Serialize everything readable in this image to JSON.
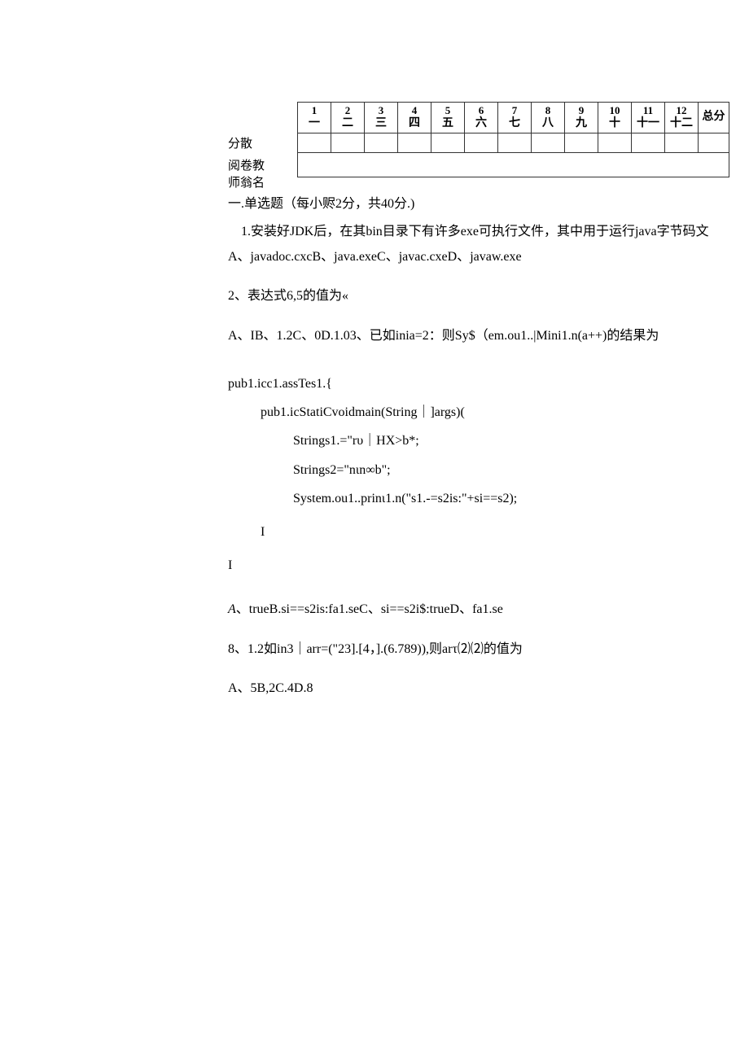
{
  "table": {
    "headers_num": [
      "1",
      "2",
      "3",
      "4",
      "5",
      "6",
      "7",
      "8",
      "9",
      "10",
      "11",
      "12"
    ],
    "headers_cn": [
      "一",
      "二",
      "三",
      "四",
      "五",
      "六",
      "七",
      "八",
      "九",
      "十",
      "十一",
      "十二"
    ],
    "total_num": "",
    "total_cn": "总分",
    "row_label_1": "分散",
    "row_label_2_line1": "阅卷教",
    "row_label_2_line2": "师翁名"
  },
  "section_title": "一.单选题（每小赆2分，共40分.)",
  "q1_line1": "1.安装好JDK后，在其bin目录下有许多exe可执行文件，其中用于运行java字节码文",
  "q1_line2": "A、javadoc.cxcB、java.exeC、javac.cxeD、javaw.exe",
  "q2": "2、表达式6,5的值为«",
  "q2_opts": "A、IB、1.2C、0D.1.03、已如inia=2：则Sy$（em.ou1..|Mini1.n(a++)的结果为",
  "code": {
    "l1": "pub1.icc1.assTes1.{",
    "l2": "pub1.icStatiCvoidmain(String｜]args)(",
    "l3": "Strings1.=\"rυ｜HX>b*;",
    "l4": "Strings2=\"nιn∞b\";",
    "l5": "System.ou1..prinι1.n(\"s1.-=s2is:\"+si==s2);",
    "brace1": "I",
    "brace2": "I"
  },
  "q_after_code_label": "A",
  "q_after_code_rest": "、trueB.si==s2is:fa1.seC、si==s2i$:trueD、fa1.se",
  "q8": "8、1.2如in3｜arr=(\"23].[4，].(6.789)),则arτ⑵⑵的值为",
  "q8_opts": "A、5B,2C.4D.8"
}
